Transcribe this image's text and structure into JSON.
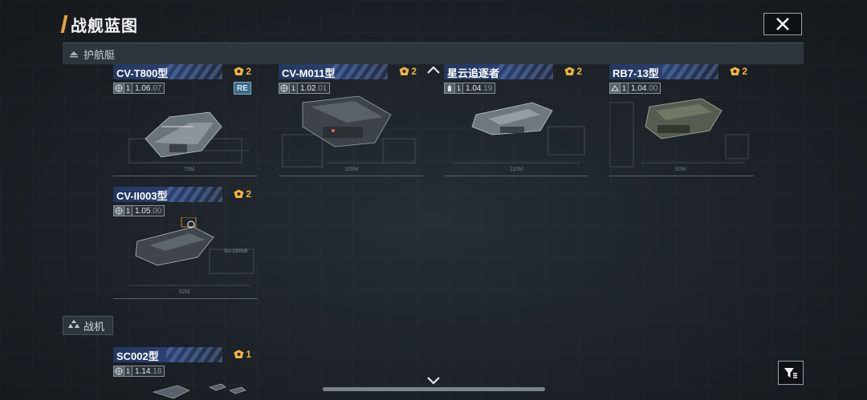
{
  "header": {
    "title": "战舰蓝图"
  },
  "sections": [
    {
      "label": "护航艇",
      "icon": "escort-ship-icon"
    },
    {
      "label": "战机",
      "icon": "fighter-squadron-icon"
    }
  ],
  "escort_cards": [
    {
      "name": "CV-T800型",
      "badge": "2",
      "tier": "1",
      "version": "1.06",
      "version_suffix": ".07",
      "tag": "RE",
      "length": "75M"
    },
    {
      "name": "CV-M011型",
      "badge": "2",
      "tier": "1",
      "version": "1.02",
      "version_suffix": ".01",
      "length": "105M"
    },
    {
      "name": "星云追逐者",
      "badge": "2",
      "tier": "1",
      "version": "1.04",
      "version_suffix": ".19",
      "length": "110M"
    },
    {
      "name": "RB7-13型",
      "badge": "2",
      "tier": "1",
      "version": "1.04",
      "version_suffix": ".00",
      "length": "80M"
    },
    {
      "name": "CV-II003型",
      "badge": "2",
      "tier": "1",
      "version": "1.05",
      "version_suffix": ".00",
      "length": "82M",
      "code": "SU-3305/B"
    }
  ],
  "fighter_cards": [
    {
      "name": "SC002型",
      "badge": "1",
      "tier": "1",
      "version": "1.14",
      "version_suffix": ".18"
    }
  ],
  "colors": {
    "accent": "#e9a33a",
    "badge": "#f0b43c",
    "card_header": "#2a4172"
  },
  "icons": {
    "close": "close-icon",
    "filter": "filter-icon",
    "badge": "rank-badge-icon",
    "globe": "globe-icon",
    "collapse": "chevron-up-icon",
    "expand": "chevron-down-icon"
  }
}
